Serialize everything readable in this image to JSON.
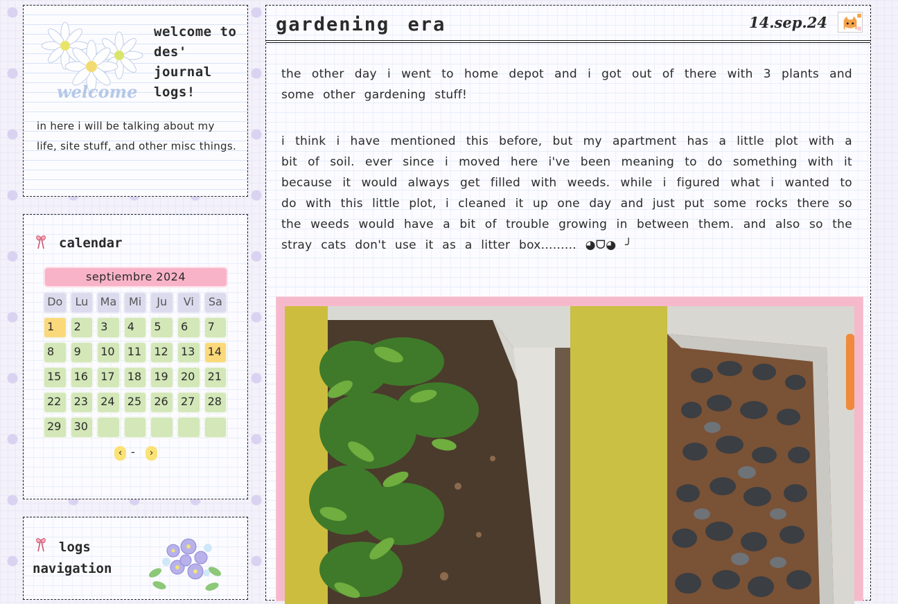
{
  "welcome": {
    "title": "welcome to des' journal logs!",
    "script_word": "welcome",
    "description": "in here i will be talking about my life, site stuff, and other misc things."
  },
  "calendar": {
    "heading": "calendar",
    "month": "septiembre 2024",
    "weekdays": [
      "Do",
      "Lu",
      "Ma",
      "Mi",
      "Ju",
      "Vi",
      "Sa"
    ],
    "days": [
      "1",
      "2",
      "3",
      "4",
      "5",
      "6",
      "7",
      "8",
      "9",
      "10",
      "11",
      "12",
      "13",
      "14",
      "15",
      "16",
      "17",
      "18",
      "19",
      "20",
      "21",
      "22",
      "23",
      "24",
      "25",
      "26",
      "27",
      "28",
      "29",
      "30",
      "",
      "",
      "",
      "",
      ""
    ],
    "highlighted_days": [
      "1",
      "14"
    ],
    "prev_glyph": "‹",
    "separator": "-",
    "next_glyph": "›"
  },
  "logs_nav": {
    "heading_line1": "logs",
    "heading_line2": "navigation"
  },
  "post": {
    "title": "gardening era",
    "date": "14.sep.24",
    "paragraphs": [
      "the other day i went to home depot and i got out of there with 3 plants and some other gardening stuff!",
      "i think i have mentioned this before, but my apartment has a little plot with a bit of soil. ever since i moved here i've been meaning to do something with it because it would always get filled with weeds. while i figured what i wanted to do with this little plot, i cleaned it up one day and just put some rocks there so the weeds would have a bit of trouble growing in between them. and also so the stray cats don't use it as a litter box......... ◕ᗜ◕ ╯"
    ]
  },
  "icons": {
    "bow": "bow-icon",
    "daisy": "daisy-icon",
    "cat": "cat-icon",
    "flowers": "flower-bouquet-icon"
  },
  "colors": {
    "month_bg": "#f9b3c8",
    "day_bg": "#d3e7b8",
    "highlight_bg": "#fbd97b",
    "weekday_bg": "#dcdbee",
    "photo_frame": "#f6b9cb"
  }
}
